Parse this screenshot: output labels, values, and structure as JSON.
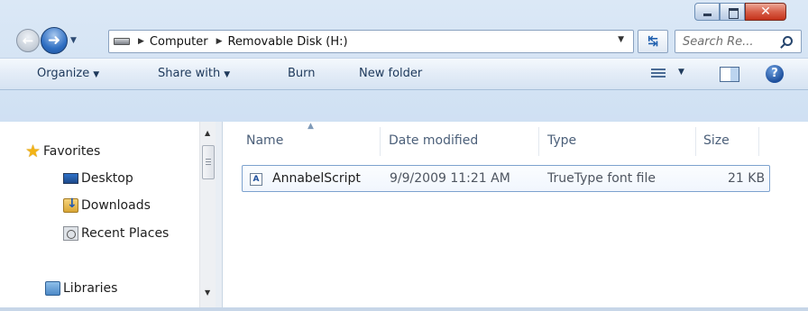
{
  "window": {
    "min_label": "",
    "max_label": "",
    "close_label": "✕"
  },
  "navigation": {
    "back_glyph": "←",
    "forward_glyph": "➜"
  },
  "address": {
    "crumbs": [
      "Computer",
      "Removable Disk (H:)"
    ]
  },
  "search": {
    "placeholder": "Search Re..."
  },
  "toolbar": {
    "organize": "Organize",
    "share_with": "Share with",
    "burn": "Burn",
    "new_folder": "New folder",
    "help": "?"
  },
  "sidebar": {
    "items": [
      {
        "label": "Favorites",
        "icon": "star-icon"
      },
      {
        "label": "Desktop",
        "icon": "desktop-icon"
      },
      {
        "label": "Downloads",
        "icon": "downloads-icon"
      },
      {
        "label": "Recent Places",
        "icon": "recent-places-icon"
      },
      {
        "label": "Libraries",
        "icon": "libraries-icon"
      }
    ]
  },
  "file_list": {
    "columns": [
      "Name",
      "Date modified",
      "Type",
      "Size"
    ],
    "rows": [
      {
        "name": "AnnabelScript",
        "date_modified": "9/9/2009 11:21 AM",
        "type": "TrueType font file",
        "size": "21 KB",
        "icon": "font-file-icon"
      }
    ]
  },
  "colors": {
    "accent": "#1e395b",
    "selection_border": "#7da2ce",
    "chrome": "#dbe8f6"
  }
}
